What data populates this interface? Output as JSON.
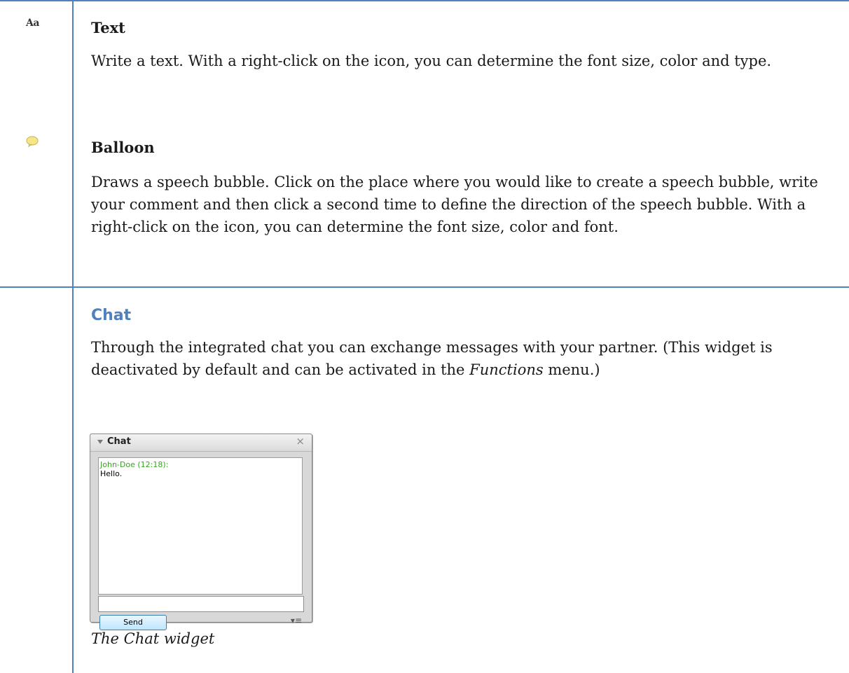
{
  "rows": {
    "text": {
      "icon": "text-aa-icon",
      "icon_glyph": "Aa",
      "title": "Text",
      "description": "Write a text. With a right-click on the icon, you can determine the font size, color and type."
    },
    "balloon": {
      "icon": "speech-balloon-icon",
      "title": "Balloon",
      "description": "Draws a speech bubble. Click on the place where you would like to create a speech bubble, write your comment and then click a second time to define the direction of the speech bubble. With a right-click on the icon, you can determine the font size, color and font."
    },
    "chat": {
      "title": "Chat",
      "description_before": "Through the integrated chat you can exchange messages with your partner. (This widget is deactivated by default and can be activated in the ",
      "description_italic": "Functions",
      "description_after": " menu.)",
      "caption": "The Chat widget"
    }
  },
  "widget": {
    "title": "Chat",
    "close_glyph": "×",
    "messages": [
      {
        "from": "John-Doe (12:18):",
        "text": "Hello."
      }
    ],
    "input_value": "",
    "send_label": "Send",
    "options_glyph": "▾≡"
  },
  "colors": {
    "table_border": "#4f81bd",
    "heading_blue": "#4f81bd",
    "chat_sender": "#3ca024"
  }
}
